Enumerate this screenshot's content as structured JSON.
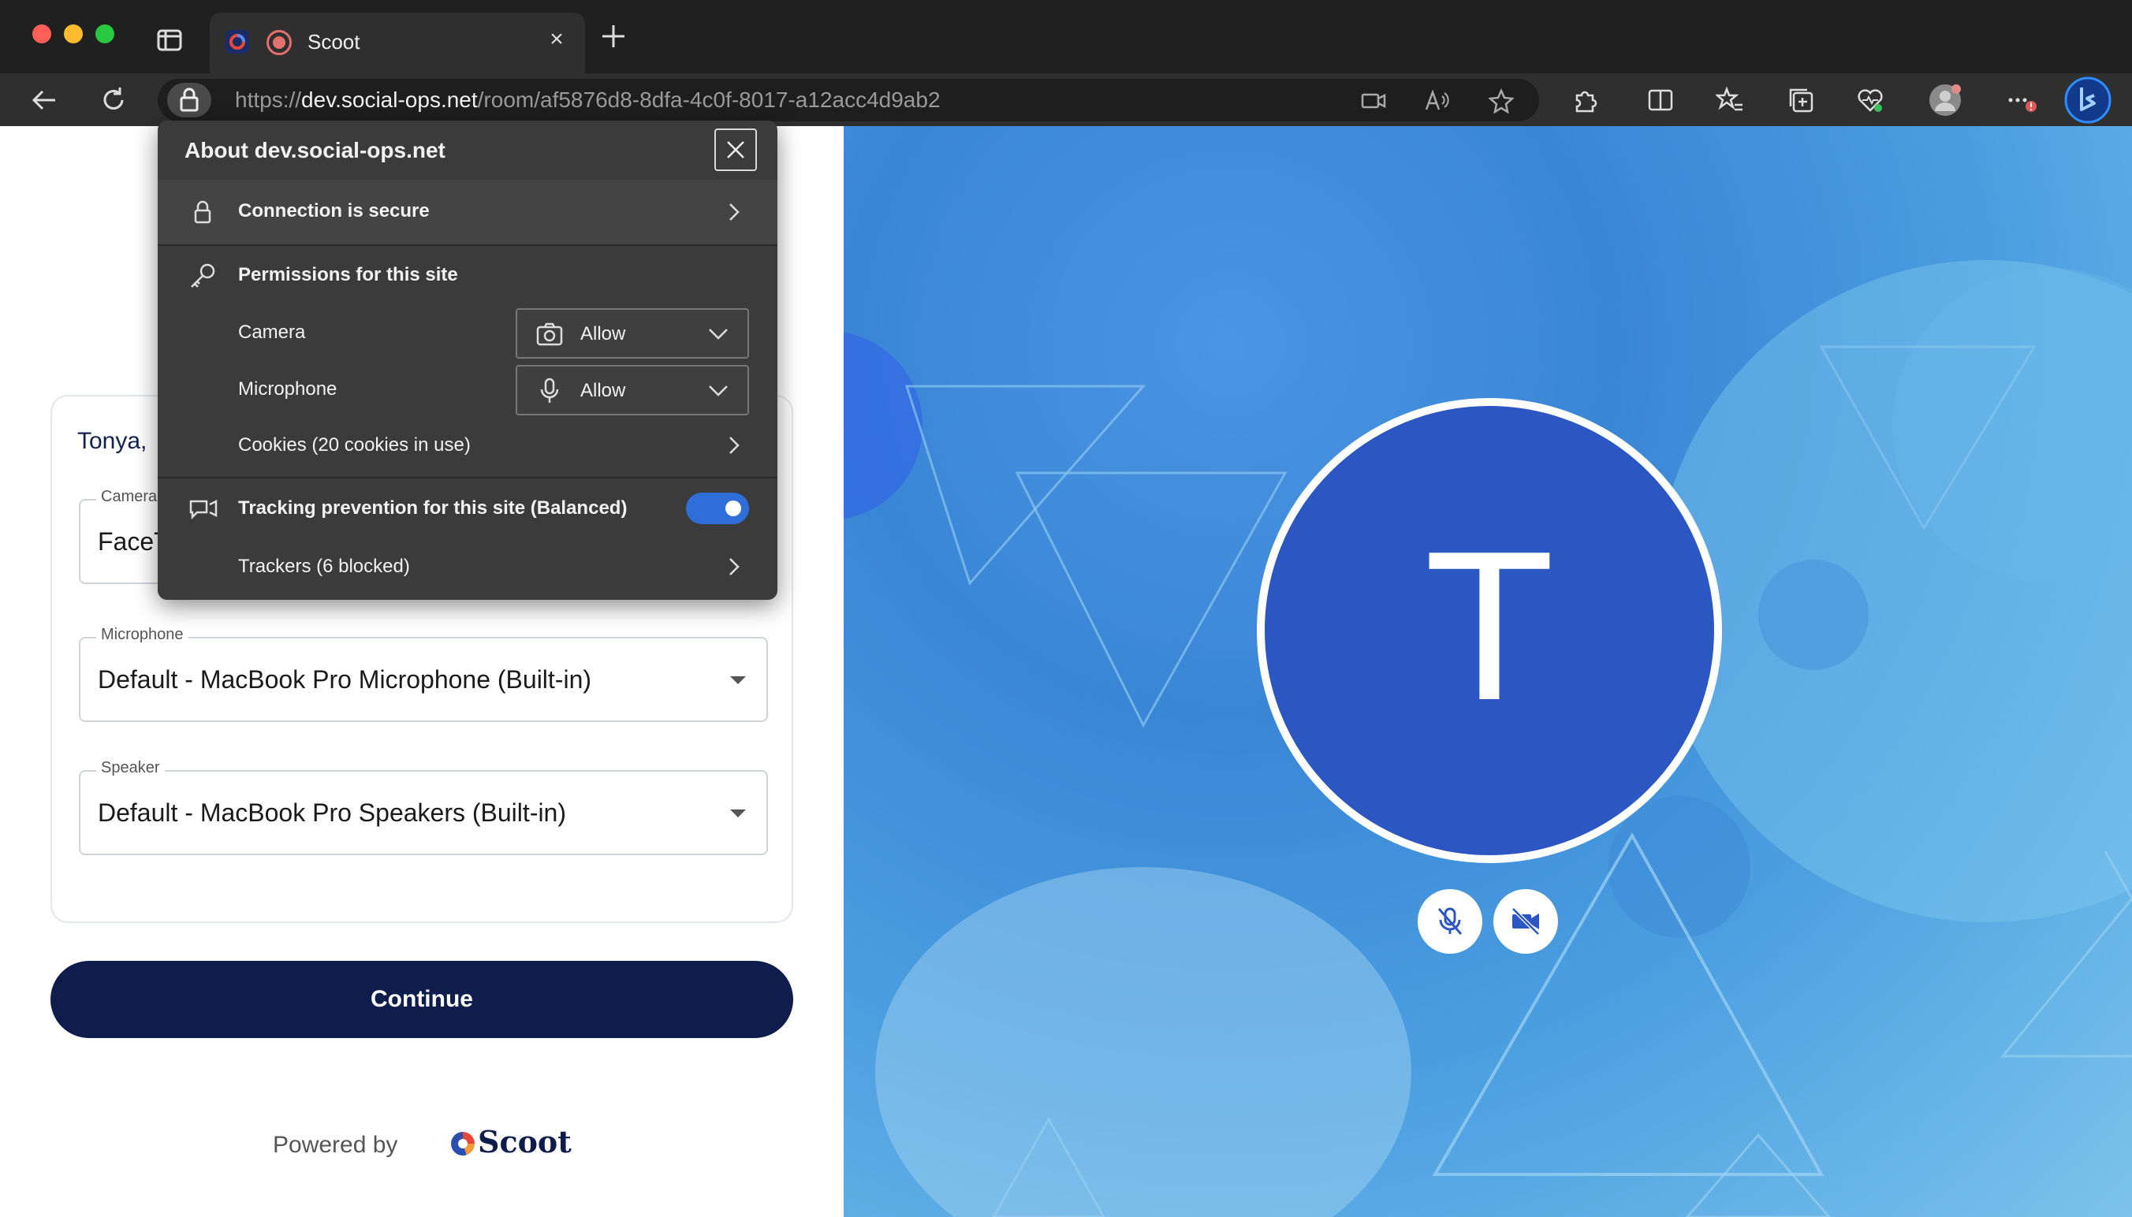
{
  "browser": {
    "tab": {
      "title": "Scoot"
    },
    "url": {
      "scheme": "https://",
      "host": "dev.social-ops.net",
      "path": "/room/af5876d8-8dfa-4c0f-8017-a12acc4d9ab2"
    }
  },
  "flyout": {
    "title": "About dev.social-ops.net",
    "connection_label": "Connection is secure",
    "permissions_heading": "Permissions for this site",
    "camera_label": "Camera",
    "camera_value": "Allow",
    "microphone_label": "Microphone",
    "microphone_value": "Allow",
    "cookies_label": "Cookies (20 cookies in use)",
    "tracking_label": "Tracking prevention for this site (Balanced)",
    "tracking_enabled": true,
    "trackers_label": "Trackers (6 blocked)"
  },
  "setup": {
    "greeting": "Tonya,",
    "camera_label": "Camera",
    "camera_value": "FaceTime HD Camera",
    "microphone_label": "Microphone",
    "microphone_value": "Default - MacBook Pro Microphone (Built-in)",
    "speaker_label": "Speaker",
    "speaker_value": "Default - MacBook Pro Speakers (Built-in)",
    "continue_label": "Continue",
    "powered_by": "Powered by",
    "brand_name": "Scoot"
  },
  "preview": {
    "avatar_initial": "T",
    "mic_muted": true,
    "camera_off": true
  },
  "colors": {
    "accent": "#2f6dd9",
    "continue_bg": "#0f1d4d",
    "avatar_bg": "#2c57c3"
  }
}
